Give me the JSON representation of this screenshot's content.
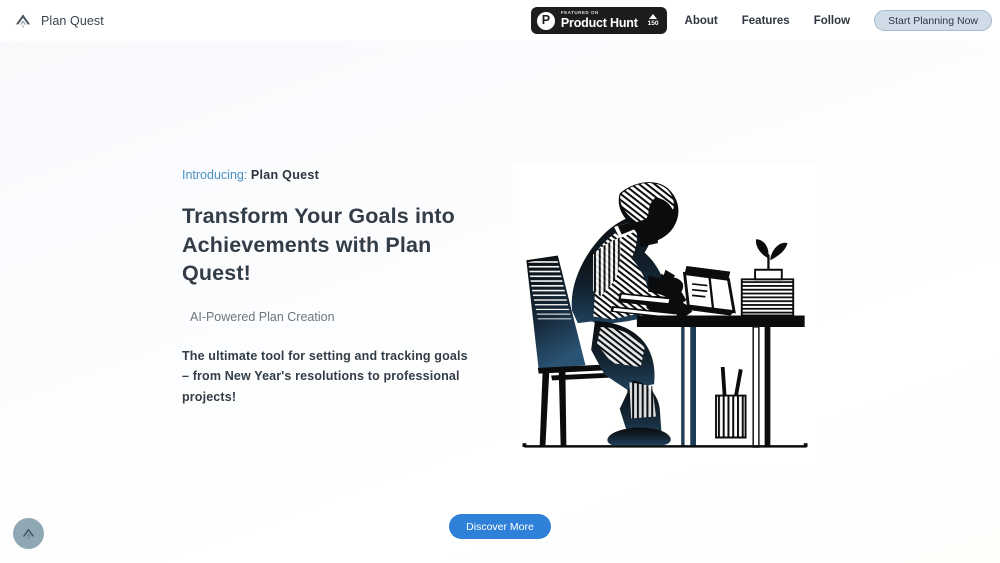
{
  "header": {
    "brand": {
      "name": "Plan Quest",
      "icon": "mountain-logo-icon"
    },
    "product_hunt": {
      "logo_letter": "P",
      "featured_label": "FEATURED ON",
      "name": "Product Hunt",
      "upvote_count": "150",
      "caret_icon": "triangle-up-icon",
      "background_color": "#1d1d1d"
    },
    "nav": [
      {
        "label": "About"
      },
      {
        "label": "Features"
      },
      {
        "label": "Follow"
      }
    ],
    "cta": {
      "label": "Start Planning Now",
      "background_color": "#cfdbe6"
    }
  },
  "hero": {
    "eyebrow_label": "Introducing:",
    "eyebrow_product": "Plan Quest",
    "eyebrow_color": "#4a90c4",
    "headline": "Transform Your Goals into Achievements with Plan Quest!",
    "subhead": "AI-Powered Plan Creation",
    "lede": "The ultimate tool for setting and tracking goals – from New Year's resolutions to professional projects!",
    "illustration_alt": "person-writing-at-desk-illustration"
  },
  "footer": {
    "discover_label": "Discover More",
    "discover_color": "#2f80d8",
    "scroll_top_icon": "chevron-up-icon",
    "scroll_top_color": "#8fa8b3"
  }
}
